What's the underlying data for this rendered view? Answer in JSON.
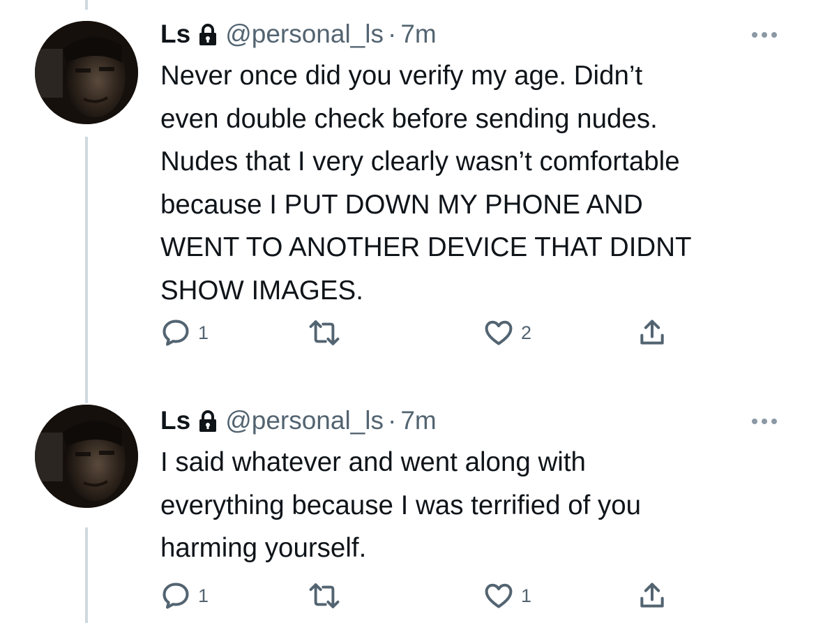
{
  "tweets": [
    {
      "display_name": "Ls",
      "handle": "@personal_ls",
      "separator": "·",
      "time": "7m",
      "text": "Never once did you verify my age. Didn’t\neven double check before sending nudes.\nNudes that I very clearly wasn’t comfortable\nbecause I PUT DOWN MY PHONE AND\nWENT TO ANOTHER DEVICE THAT DIDNT\nSHOW IMAGES.",
      "reply_count": "1",
      "retweet_count": "",
      "like_count": "2",
      "icons": {
        "lock": "lock-icon",
        "more": "more-icon",
        "reply": "reply-icon",
        "retweet": "retweet-icon",
        "like": "heart-icon",
        "share": "share-icon"
      }
    },
    {
      "display_name": "Ls",
      "handle": "@personal_ls",
      "separator": "·",
      "time": "7m",
      "text": "I said whatever and went along with\neverything because I was terrified of you\nharming yourself.",
      "reply_count": "1",
      "retweet_count": "",
      "like_count": "1",
      "icons": {
        "lock": "lock-icon",
        "more": "more-icon",
        "reply": "reply-icon",
        "retweet": "retweet-icon",
        "like": "heart-icon",
        "share": "share-icon"
      }
    }
  ],
  "colors": {
    "text": "#0f1419",
    "secondary": "#536471",
    "thread_line": "#cfd9de"
  }
}
